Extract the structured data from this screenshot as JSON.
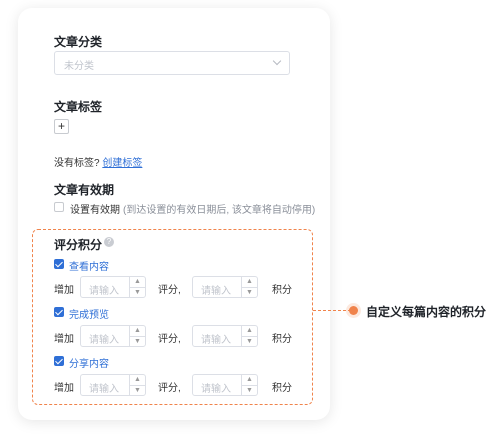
{
  "category": {
    "label": "文章分类",
    "select_placeholder": "未分类"
  },
  "tags": {
    "label": "文章标签",
    "add_symbol": "+",
    "no_tags_text": "没有标签?",
    "create_link": "创建标签"
  },
  "validity": {
    "label": "文章有效期",
    "checkbox_label": "设置有效期",
    "note": "(到达设置的有效日期后, 该文章将自动停用)"
  },
  "scoring": {
    "label": "评分积分",
    "help_symbol": "?",
    "items": [
      {
        "name": "查看内容",
        "checked": true,
        "add_label": "增加",
        "input_placeholder": "请输入",
        "score_label": "评分,",
        "points_label": "积分"
      },
      {
        "name": "完成预览",
        "checked": true,
        "add_label": "增加",
        "input_placeholder": "请输入",
        "score_label": "评分,",
        "points_label": "积分"
      },
      {
        "name": "分享内容",
        "checked": true,
        "add_label": "增加",
        "input_placeholder": "请输入",
        "score_label": "评分,",
        "points_label": "积分"
      }
    ]
  },
  "callout": {
    "text": "自定义每篇内容的积分"
  },
  "colors": {
    "accent": "#2f6fd6",
    "callout": "#f0834b"
  }
}
